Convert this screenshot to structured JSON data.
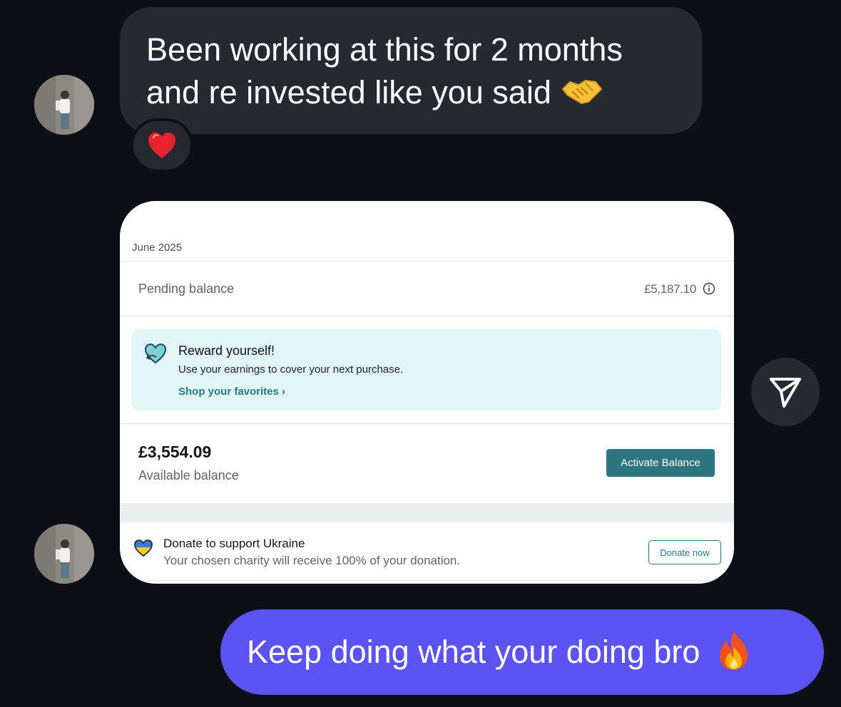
{
  "messages": {
    "incoming": {
      "line1": "Been working at this for 2 months",
      "line2": "and re invested like you said",
      "emoji": "handshake-emoji",
      "reaction": "red-heart-emoji"
    },
    "outgoing": {
      "text": "Keep doing what your doing bro",
      "emoji": "fire-emoji"
    }
  },
  "shared_screenshot": {
    "month": "June 2025",
    "pending": {
      "label": "Pending balance",
      "value": "£5,187.10"
    },
    "promo": {
      "title": "Reward yourself!",
      "body": "Use your earnings to cover your next purchase.",
      "link": "Shop your favorites"
    },
    "available": {
      "amount": "£3,554.09",
      "label": "Available balance",
      "button": "Activate Balance"
    },
    "donate": {
      "title": "Donate to support Ukraine",
      "body": "Your chosen charity will receive 100% of your donation.",
      "button": "Donate now"
    }
  },
  "colors": {
    "background": "#0c1014",
    "incoming_bubble": "#262a30",
    "outgoing_bubble": "#5d52f3",
    "accent_teal": "#2e7580",
    "promo_bg": "#e1f6f6"
  },
  "icons": {
    "share": "send-icon",
    "info": "info-icon",
    "promo": "heart-arrow-icon",
    "donate": "ukraine-heart-icon"
  }
}
